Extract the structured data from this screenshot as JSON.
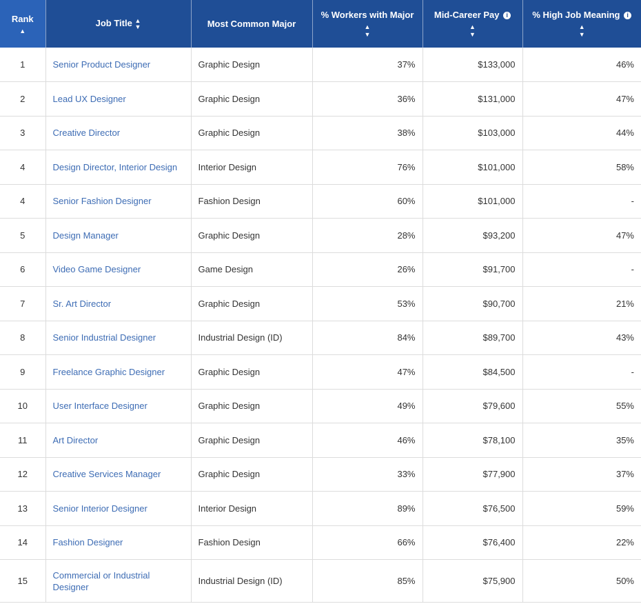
{
  "headers": {
    "rank": "Rank",
    "job_title": "Job Title",
    "major": "Most Common Major",
    "pct_workers": "% Workers with Major",
    "mid_pay": "Mid-Career Pay",
    "meaning": "% High Job Meaning"
  },
  "icons": {
    "sort_asc": "sort-ascending-icon",
    "sort_both": "sort-both-icon",
    "info": "info-icon"
  },
  "colors": {
    "header_bg": "#1f4e96",
    "header_sorted_bg": "#2b63b8",
    "link": "#3d6cb4"
  },
  "rows": [
    {
      "rank": "1",
      "title": "Senior Product Designer",
      "major": "Graphic Design",
      "pct": "37%",
      "pay": "$133,000",
      "meaning": "46%"
    },
    {
      "rank": "2",
      "title": "Lead UX Designer",
      "major": "Graphic Design",
      "pct": "36%",
      "pay": "$131,000",
      "meaning": "47%"
    },
    {
      "rank": "3",
      "title": "Creative Director",
      "major": "Graphic Design",
      "pct": "38%",
      "pay": "$103,000",
      "meaning": "44%"
    },
    {
      "rank": "4",
      "title": "Design Director, Interior Design",
      "major": "Interior Design",
      "pct": "76%",
      "pay": "$101,000",
      "meaning": "58%"
    },
    {
      "rank": "4",
      "title": "Senior Fashion Designer",
      "major": "Fashion Design",
      "pct": "60%",
      "pay": "$101,000",
      "meaning": "-"
    },
    {
      "rank": "5",
      "title": "Design Manager",
      "major": "Graphic Design",
      "pct": "28%",
      "pay": "$93,200",
      "meaning": "47%"
    },
    {
      "rank": "6",
      "title": "Video Game Designer",
      "major": "Game Design",
      "pct": "26%",
      "pay": "$91,700",
      "meaning": "-"
    },
    {
      "rank": "7",
      "title": "Sr. Art Director",
      "major": "Graphic Design",
      "pct": "53%",
      "pay": "$90,700",
      "meaning": "21%"
    },
    {
      "rank": "8",
      "title": "Senior Industrial Designer",
      "major": "Industrial Design (ID)",
      "pct": "84%",
      "pay": "$89,700",
      "meaning": "43%"
    },
    {
      "rank": "9",
      "title": "Freelance Graphic Designer",
      "major": "Graphic Design",
      "pct": "47%",
      "pay": "$84,500",
      "meaning": "-"
    },
    {
      "rank": "10",
      "title": "User Interface Designer",
      "major": "Graphic Design",
      "pct": "49%",
      "pay": "$79,600",
      "meaning": "55%"
    },
    {
      "rank": "11",
      "title": "Art Director",
      "major": "Graphic Design",
      "pct": "46%",
      "pay": "$78,100",
      "meaning": "35%"
    },
    {
      "rank": "12",
      "title": "Creative Services Manager",
      "major": "Graphic Design",
      "pct": "33%",
      "pay": "$77,900",
      "meaning": "37%"
    },
    {
      "rank": "13",
      "title": "Senior Interior Designer",
      "major": "Interior Design",
      "pct": "89%",
      "pay": "$76,500",
      "meaning": "59%"
    },
    {
      "rank": "14",
      "title": "Fashion Designer",
      "major": "Fashion Design",
      "pct": "66%",
      "pay": "$76,400",
      "meaning": "22%"
    },
    {
      "rank": "15",
      "title": "Commercial or Industrial Designer",
      "major": "Industrial Design (ID)",
      "pct": "85%",
      "pay": "$75,900",
      "meaning": "50%"
    }
  ]
}
